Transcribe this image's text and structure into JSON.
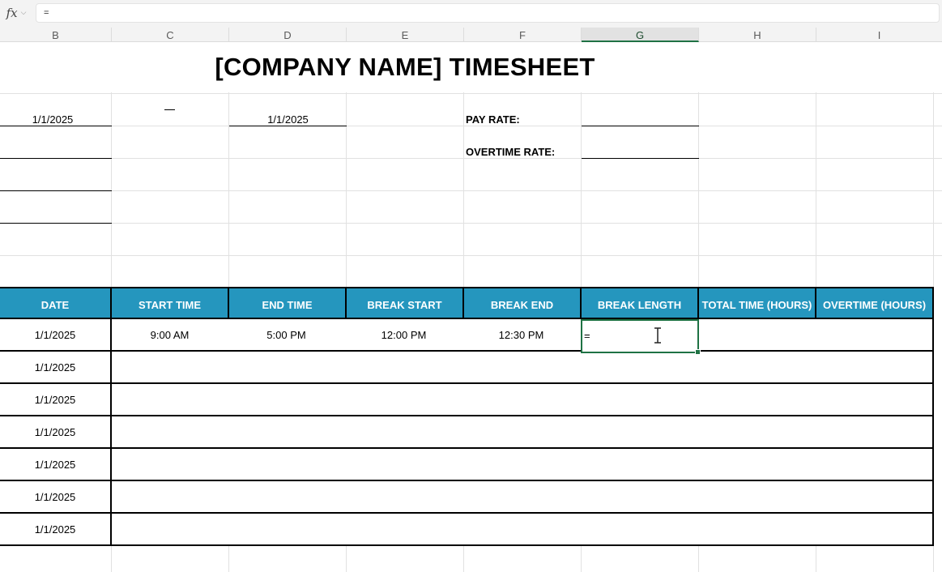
{
  "formula_bar": {
    "fx_label": "fx",
    "content": "="
  },
  "columns": [
    "B",
    "C",
    "D",
    "E",
    "F",
    "G",
    "H",
    "I"
  ],
  "selected_column": "G",
  "title": "[COMPANY NAME] TIMESHEET",
  "header_fields": {
    "b_date": "1/1/2025",
    "c_dash": "—",
    "d_date": "1/1/2025",
    "pay_rate_label": "PAY RATE:",
    "overtime_rate_label": "OVERTIME RATE:"
  },
  "table": {
    "headers": [
      "DATE",
      "START TIME",
      "END TIME",
      "BREAK START",
      "BREAK END",
      "BREAK LENGTH",
      "TOTAL TIME (HOURS)",
      "OVERTIME (HOURS)"
    ],
    "rows": [
      [
        "1/1/2025",
        "9:00 AM",
        "5:00 PM",
        "12:00 PM",
        "12:30 PM",
        "=",
        "",
        ""
      ],
      [
        "1/1/2025",
        "",
        "",
        "",
        "",
        "",
        "",
        ""
      ],
      [
        "1/1/2025",
        "",
        "",
        "",
        "",
        "",
        "",
        ""
      ],
      [
        "1/1/2025",
        "",
        "",
        "",
        "",
        "",
        "",
        ""
      ],
      [
        "1/1/2025",
        "",
        "",
        "",
        "",
        "",
        "",
        ""
      ],
      [
        "1/1/2025",
        "",
        "",
        "",
        "",
        "",
        "",
        ""
      ],
      [
        "1/1/2025",
        "",
        "",
        "",
        "",
        "",
        "",
        ""
      ]
    ]
  },
  "colors": {
    "header_fill": "#2596be",
    "selection": "#1f7244"
  }
}
